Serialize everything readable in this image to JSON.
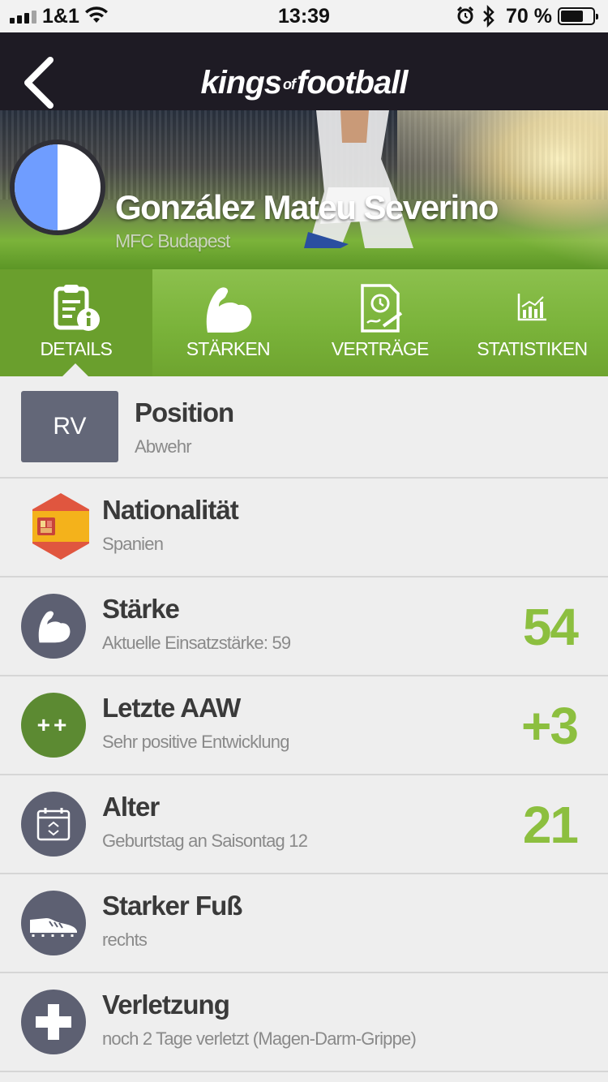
{
  "status_bar": {
    "carrier": "1&1",
    "time": "13:39",
    "battery": "70 %",
    "battery_level": 0.7
  },
  "navbar": {
    "logo_left": "kings",
    "logo_of": "of",
    "logo_right": "football"
  },
  "player": {
    "name": "González Mateu Severino",
    "club": "MFC Budapest",
    "club_colors": [
      "#6f9dff",
      "#ffffff"
    ]
  },
  "tabs": [
    {
      "label": "DETAILS",
      "icon": "details-icon",
      "active": true
    },
    {
      "label": "STÄRKEN",
      "icon": "muscle-icon",
      "active": false
    },
    {
      "label": "VERTRÄGE",
      "icon": "contract-icon",
      "active": false
    },
    {
      "label": "STATISTIKEN",
      "icon": "chart-icon",
      "active": false
    }
  ],
  "details": [
    {
      "title": "Position",
      "sub": "Abwehr",
      "badge": "RV"
    },
    {
      "title": "Nationalität",
      "sub": "Spanien",
      "icon": "spain-flag-icon"
    },
    {
      "title": "Stärke",
      "sub": "Aktuelle Einsatzstärke: 59",
      "value": "54",
      "icon": "muscle-icon"
    },
    {
      "title": "Letzte AAW",
      "sub": "Sehr positive Entwicklung",
      "value": "+3",
      "badge": "++"
    },
    {
      "title": "Alter",
      "sub": "Geburtstag an Saisontag 12",
      "value": "21",
      "icon": "calendar-icon"
    },
    {
      "title": "Starker Fuß",
      "sub": "rechts",
      "icon": "boot-icon"
    },
    {
      "title": "Verletzung",
      "sub": "noch 2 Tage verletzt (Magen-Darm-Grippe)",
      "icon": "injury-cross-icon"
    }
  ],
  "colors": {
    "accent_green": "#8cbf3f",
    "tab_green": "#7ab33a",
    "navbar": "#1e1b24",
    "icon_circle": "#5d6072"
  }
}
